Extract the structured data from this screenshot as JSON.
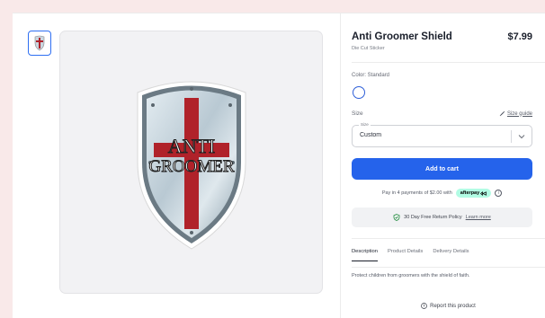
{
  "product": {
    "title": "Anti Groomer Shield",
    "subtitle": "Die Cut Sticker",
    "price": "$7.99",
    "image_text_line1": "ANTI",
    "image_text_line2": "GROOMER"
  },
  "options": {
    "color_label": "Color: Standard",
    "size_label": "Size",
    "size_guide_label": "Size guide",
    "size_select_legend": "Size",
    "size_select_value": "Custom"
  },
  "actions": {
    "add_to_cart_label": "Add to cart"
  },
  "afterpay": {
    "text": "Pay in 4 payments of $2.00 with",
    "badge_label": "afterpay",
    "info_glyph": "i"
  },
  "returns": {
    "text": "30 Day Free Return Policy",
    "link_label": "Learn more"
  },
  "tabs": [
    {
      "label": "Description",
      "active": true
    },
    {
      "label": "Product Details",
      "active": false
    },
    {
      "label": "Delivery Details",
      "active": false
    }
  ],
  "description": "Protect children from groomers with the shield of faith.",
  "report_label": "Report this product",
  "colors": {
    "accent": "#2563eb",
    "afterpay_mint": "#b2fce4",
    "page_bg": "#f9e9e9",
    "cross_red": "#b0222a",
    "shield_silver": "#c9d6df"
  }
}
